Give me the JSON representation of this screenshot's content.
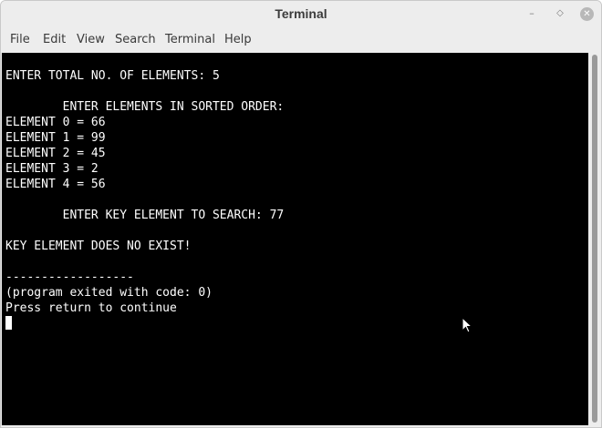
{
  "window": {
    "title": "Terminal",
    "buttons": {
      "minimize_icon": "minimize-icon",
      "maximize_icon": "maximize-icon",
      "close_icon": "close-icon"
    }
  },
  "menubar": {
    "items": [
      {
        "label": "File"
      },
      {
        "label": "Edit"
      },
      {
        "label": "View"
      },
      {
        "label": "Search"
      },
      {
        "label": "Terminal"
      },
      {
        "label": "Help"
      }
    ]
  },
  "terminal": {
    "background": "#000000",
    "foreground": "#ffffff",
    "lines": [
      "ENTER TOTAL NO. OF ELEMENTS: 5",
      "",
      "        ENTER ELEMENTS IN SORTED ORDER:",
      "ELEMENT 0 = 66",
      "ELEMENT 1 = 99",
      "ELEMENT 2 = 45",
      "ELEMENT 3 = 2",
      "ELEMENT 4 = 56",
      "",
      "        ENTER KEY ELEMENT TO SEARCH: 77",
      "",
      "KEY ELEMENT DOES NO EXIST!",
      "",
      "------------------",
      "(program exited with code: 0)",
      "Press return to continue"
    ]
  }
}
